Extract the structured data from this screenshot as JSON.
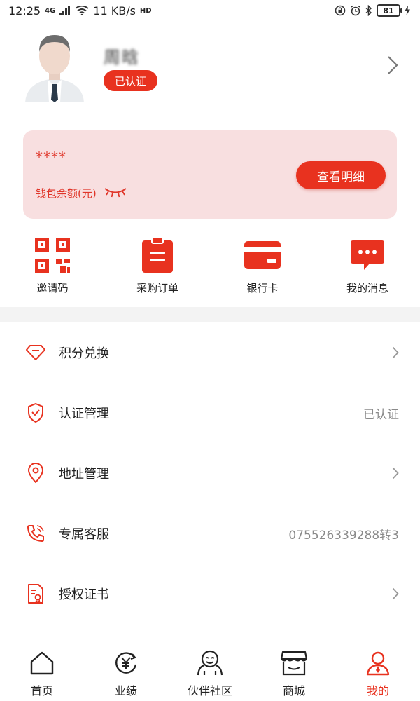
{
  "status_bar": {
    "time": "12:25",
    "signal": "4G",
    "speed": "11 KB/s",
    "hd": "HD",
    "battery": "81"
  },
  "profile": {
    "name": "周晗",
    "badge": "已认证"
  },
  "wallet": {
    "amount_masked": "****",
    "label": "钱包余额(元)",
    "detail_button": "查看明细"
  },
  "quick_actions": [
    {
      "label": "邀请码",
      "icon": "qr-code-icon"
    },
    {
      "label": "采购订单",
      "icon": "clipboard-icon"
    },
    {
      "label": "银行卡",
      "icon": "bank-card-icon"
    },
    {
      "label": "我的消息",
      "icon": "message-icon"
    }
  ],
  "menu": [
    {
      "label": "积分兑换",
      "value": "",
      "icon": "diamond-icon"
    },
    {
      "label": "认证管理",
      "value": "已认证",
      "icon": "shield-check-icon"
    },
    {
      "label": "地址管理",
      "value": "",
      "icon": "location-pin-icon"
    },
    {
      "label": "专属客服",
      "value": "075526339288转3",
      "icon": "phone-icon"
    },
    {
      "label": "授权证书",
      "value": "",
      "icon": "certificate-icon"
    }
  ],
  "bottom_nav": [
    {
      "label": "首页",
      "icon": "home-icon"
    },
    {
      "label": "业绩",
      "icon": "yen-refresh-icon"
    },
    {
      "label": "伙伴社区",
      "icon": "community-icon"
    },
    {
      "label": "商城",
      "icon": "store-icon"
    },
    {
      "label": "我的",
      "icon": "person-icon"
    }
  ],
  "colors": {
    "accent": "#e8321f",
    "card_bg": "#f8dfe0",
    "muted_text": "#8a8a8a"
  }
}
